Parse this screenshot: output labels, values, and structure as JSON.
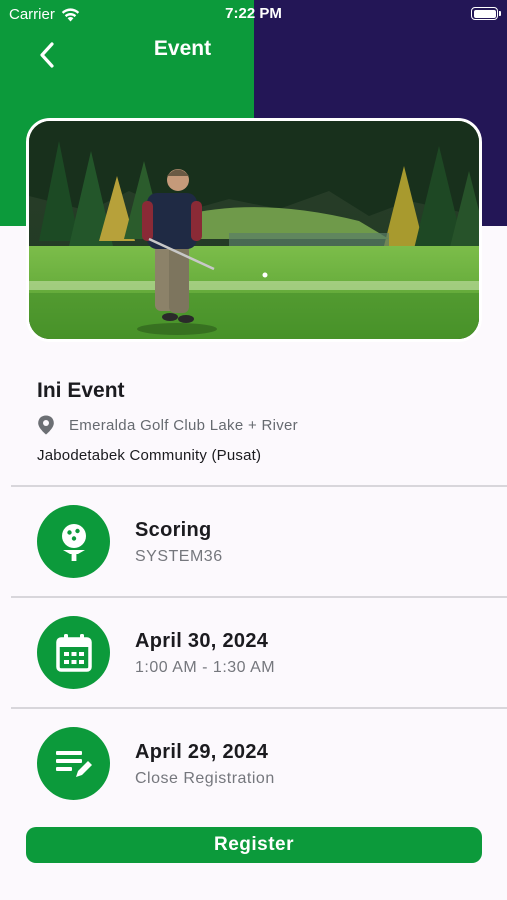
{
  "status_bar": {
    "carrier": "Carrier",
    "time": "7:22 PM"
  },
  "header": {
    "title": "Event"
  },
  "event": {
    "name": "Ini Event",
    "location": "Emeralda Golf Club Lake + River",
    "community": "Jabodetabek Community (Pusat)"
  },
  "rows": [
    {
      "title": "Scoring",
      "subtitle": "SYSTEM36"
    },
    {
      "title": "April 30, 2024",
      "subtitle": "1:00 AM - 1:30 AM"
    },
    {
      "title": "April 29, 2024",
      "subtitle": "Close Registration"
    }
  ],
  "register_label": "Register",
  "colors": {
    "primary_green": "#0c9a3b",
    "header_purple": "#231656",
    "background": "#fcf9fd"
  }
}
